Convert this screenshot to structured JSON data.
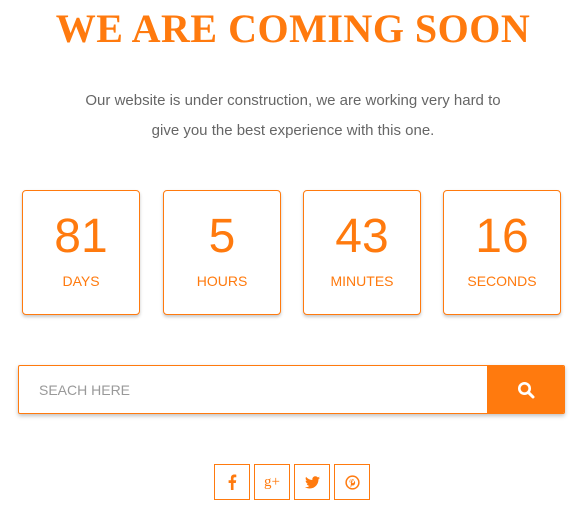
{
  "header": {
    "title": "WE ARE COMING SOON",
    "subtitle_line1": "Our website is under construction, we are working very hard to",
    "subtitle_line2": "give you the best experience with this one."
  },
  "countdown": [
    {
      "value": "81",
      "label": "DAYS"
    },
    {
      "value": "5",
      "label": "HOURS"
    },
    {
      "value": "43",
      "label": "MINUTES"
    },
    {
      "value": "16",
      "label": "SECONDS"
    }
  ],
  "search": {
    "placeholder": "SEACH HERE",
    "button_icon": "search-icon"
  },
  "social": [
    {
      "icon": "facebook-icon"
    },
    {
      "icon": "google-plus-icon",
      "glyph": "g+"
    },
    {
      "icon": "twitter-icon"
    },
    {
      "icon": "pinterest-icon"
    }
  ],
  "colors": {
    "accent": "#ff7a0e",
    "text_muted": "#666666",
    "placeholder": "#999999",
    "background": "#ffffff"
  }
}
